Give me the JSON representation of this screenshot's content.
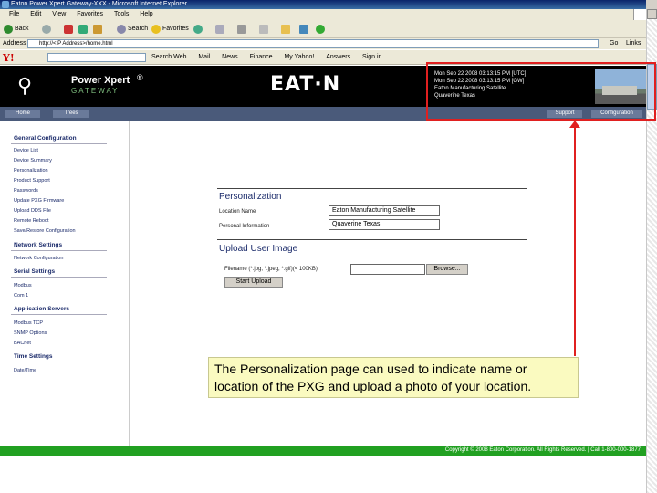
{
  "window": {
    "title": "Eaton Power Xpert Gateway-XXX - Microsoft Internet Explorer"
  },
  "menubar": {
    "items": [
      "File",
      "Edit",
      "View",
      "Favorites",
      "Tools",
      "Help"
    ]
  },
  "toolbar": {
    "back": "Back",
    "search": "Search",
    "favorites": "Favorites"
  },
  "addressbar": {
    "label": "Address",
    "url": "http://<IP Address>/home.html",
    "go": "Go",
    "links": "Links"
  },
  "yahoobar": {
    "logo": "Y!",
    "items": [
      "Search Web",
      "Mail",
      "News",
      "Finance",
      "My Yahoo!",
      "Answers",
      "Sign in"
    ]
  },
  "header": {
    "product": "Power Xpert",
    "registered": "®",
    "sub": "GATEWAY",
    "brand": "EAT·N",
    "status_lines": [
      "Mon Sep 22 2008 03:13:15 PM [UTC]",
      "Mon Sep 22 2008 03:13:15 PM [GW]",
      "Eaton Manufacturing Satellite",
      "Quaverine Texas"
    ]
  },
  "nav": {
    "home": "Home",
    "trees": "Trees",
    "support": "Support",
    "configuration": "Configuration"
  },
  "sidebar": {
    "general_heading": "General Configuration",
    "general_items": [
      "Device List",
      "Device Summary",
      "Personalization",
      "Product Support",
      "Passwords",
      "Update PXG Firmware",
      "Upload DDS File",
      "Remote Reboot",
      "Save/Restore Configuration"
    ],
    "network_heading": "Network Settings",
    "network_items": [
      "Network Configuration"
    ],
    "serial_heading": "Serial Settings",
    "serial_items": [
      "Modbus",
      "Com 1"
    ],
    "app_heading": "Application Servers",
    "app_items": [
      "Modbus TCP",
      "SNMP Options",
      "BACnet"
    ],
    "time_heading": "Time Settings",
    "time_items": [
      "Date/Time"
    ]
  },
  "personalization": {
    "title": "Personalization",
    "location_label": "Location Name",
    "location_value": "Eaton Manufacturing Satellite",
    "personal_label": "Personal Information",
    "personal_value": "Quaverine Texas"
  },
  "upload": {
    "title": "Upload User Image",
    "file_label": "Filename (*.jpg, *.jpeg, *.gif)(< 100KB)",
    "browse": "Browse...",
    "start": "Start Upload"
  },
  "footer": {
    "copyright": "Copyright © 2008 Eaton Corporation. All Rights Reserved. | Call 1-800-000-1877"
  },
  "callout": {
    "text": "The Personalization page can used to indicate name or location of the PXG and upload a photo of your location."
  }
}
